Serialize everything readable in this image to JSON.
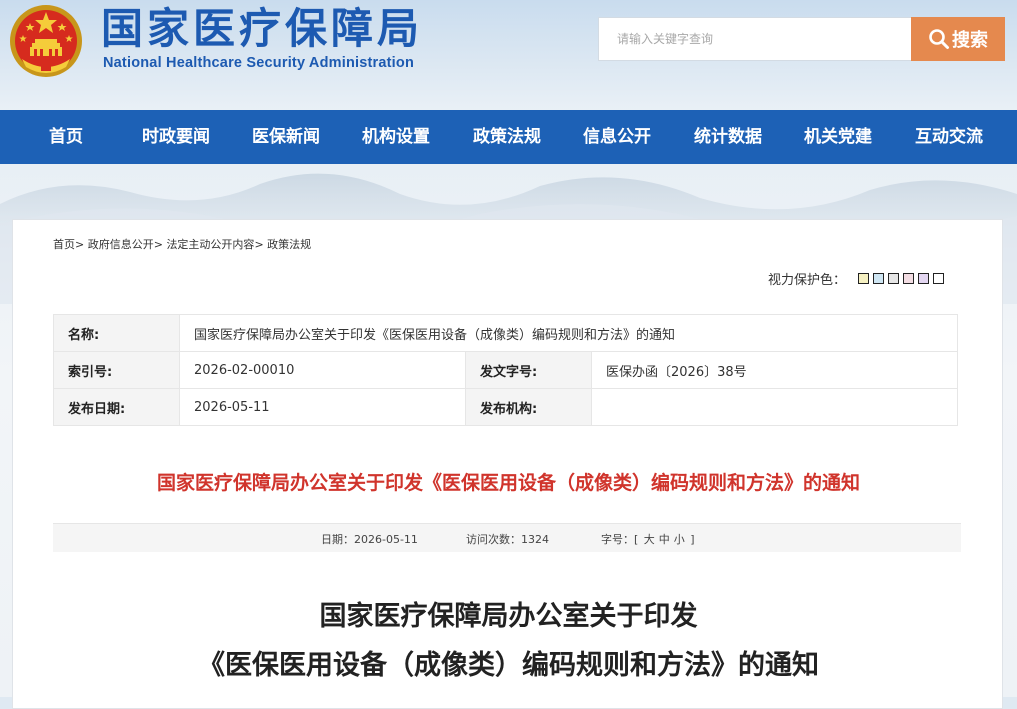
{
  "header": {
    "emblem_icon": "national-emblem-icon",
    "site_title_cn": "国家医疗保障局",
    "site_title_en": "National Healthcare Security Administration",
    "search": {
      "placeholder": "请输入关键字查询",
      "value": "",
      "button_label": "搜索",
      "button_icon": "search-icon",
      "button_color": "#e5894e"
    }
  },
  "nav": {
    "color": "#1d61b6",
    "items": [
      {
        "label": "首页"
      },
      {
        "label": "时政要闻"
      },
      {
        "label": "医保新闻"
      },
      {
        "label": "机构设置"
      },
      {
        "label": "政策法规"
      },
      {
        "label": "信息公开"
      },
      {
        "label": "统计数据"
      },
      {
        "label": "机关党建"
      },
      {
        "label": "互动交流"
      }
    ]
  },
  "breadcrumb": {
    "items": [
      "首页",
      "政府信息公开",
      "法定主动公开内容",
      "政策法规"
    ],
    "separator": ">"
  },
  "vision_protection": {
    "label": "视力保护色：",
    "colors": [
      "#f6f1c2",
      "#cfe6f3",
      "#e6e6e6",
      "#f3dde3",
      "#e3d6f1",
      "#ffffff"
    ]
  },
  "meta": {
    "name_label": "名称:",
    "name_value": "国家医疗保障局办公室关于印发《医保医用设备（成像类）编码规则和方法》的通知",
    "index_label": "索引号:",
    "index_value": "2026-02-00010",
    "docno_label": "发文字号:",
    "docno_value": "医保办函〔2026〕38号",
    "date_label": "发布日期:",
    "date_value": "2026-05-11",
    "org_label": "发布机构:",
    "org_value": ""
  },
  "document": {
    "title": "国家医疗保障局办公室关于印发《医保医用设备（成像类）编码规则和方法》的通知",
    "title_color": "#d0342c",
    "info": {
      "date_label": "日期：",
      "date_value": "2026-05-11",
      "visits_label": "访问次数：",
      "visits_value": "1324",
      "fontsize_label": "字号：",
      "bracket_open": "[",
      "size_large": "大",
      "size_medium": "中",
      "size_small": "小",
      "bracket_close": "]"
    },
    "body_title_line1": "国家医疗保障局办公室关于印发",
    "body_title_line2": "《医保医用设备（成像类）编码规则和方法》的通知"
  }
}
